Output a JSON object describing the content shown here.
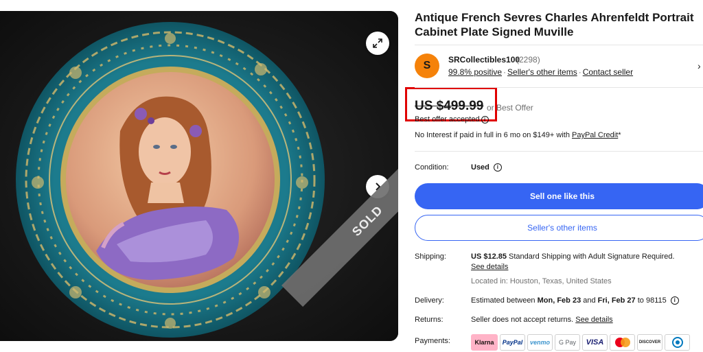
{
  "listing": {
    "title": "Antique French Sevres Charles Ahrenfeldt Portrait Cabinet Plate Signed Muville",
    "sold_badge": "SOLD"
  },
  "seller": {
    "avatar_letter": "S",
    "name": "SRCollectibles100",
    "score": "(2298)",
    "positive": "99.8% positive",
    "other_items_link": "Seller's other items",
    "contact_link": "Contact seller"
  },
  "price": {
    "amount": "US $499.99",
    "or_offer": "or Best Offer",
    "offer_accepted": "Best offer accepted",
    "paypal_prefix": "No Interest if paid in full in 6 mo on $149+ with ",
    "paypal_link": "PayPal Credit",
    "paypal_suffix": "*"
  },
  "condition": {
    "label": "Condition:",
    "value": "Used"
  },
  "buttons": {
    "sell_one": "Sell one like this",
    "seller_items": "Seller's other items"
  },
  "shipping": {
    "label": "Shipping:",
    "cost": "US $12.85",
    "method": " Standard Shipping with Adult Signature Required.",
    "details_link": "See details",
    "location": "Located in: Houston, Texas, United States"
  },
  "delivery": {
    "label": "Delivery:",
    "prefix": "Estimated between ",
    "start": "Mon, Feb 23",
    "and": " and ",
    "end": "Fri, Feb 27",
    "suffix": " to 98115"
  },
  "returns": {
    "label": "Returns:",
    "text": "Seller does not accept returns. ",
    "details_link": "See details"
  },
  "payments": {
    "label": "Payments:",
    "methods": [
      "Klarna",
      "PayPal",
      "venmo",
      "G Pay",
      "VISA",
      "Mastercard",
      "DISCOVER",
      "Diners Club"
    ]
  },
  "icons": {
    "expand": "expand-icon",
    "next": "chevron-right-icon",
    "info": "info-icon"
  },
  "colors": {
    "accent": "#3665f3",
    "avatar": "#f5820a",
    "highlight": "#e00000"
  }
}
